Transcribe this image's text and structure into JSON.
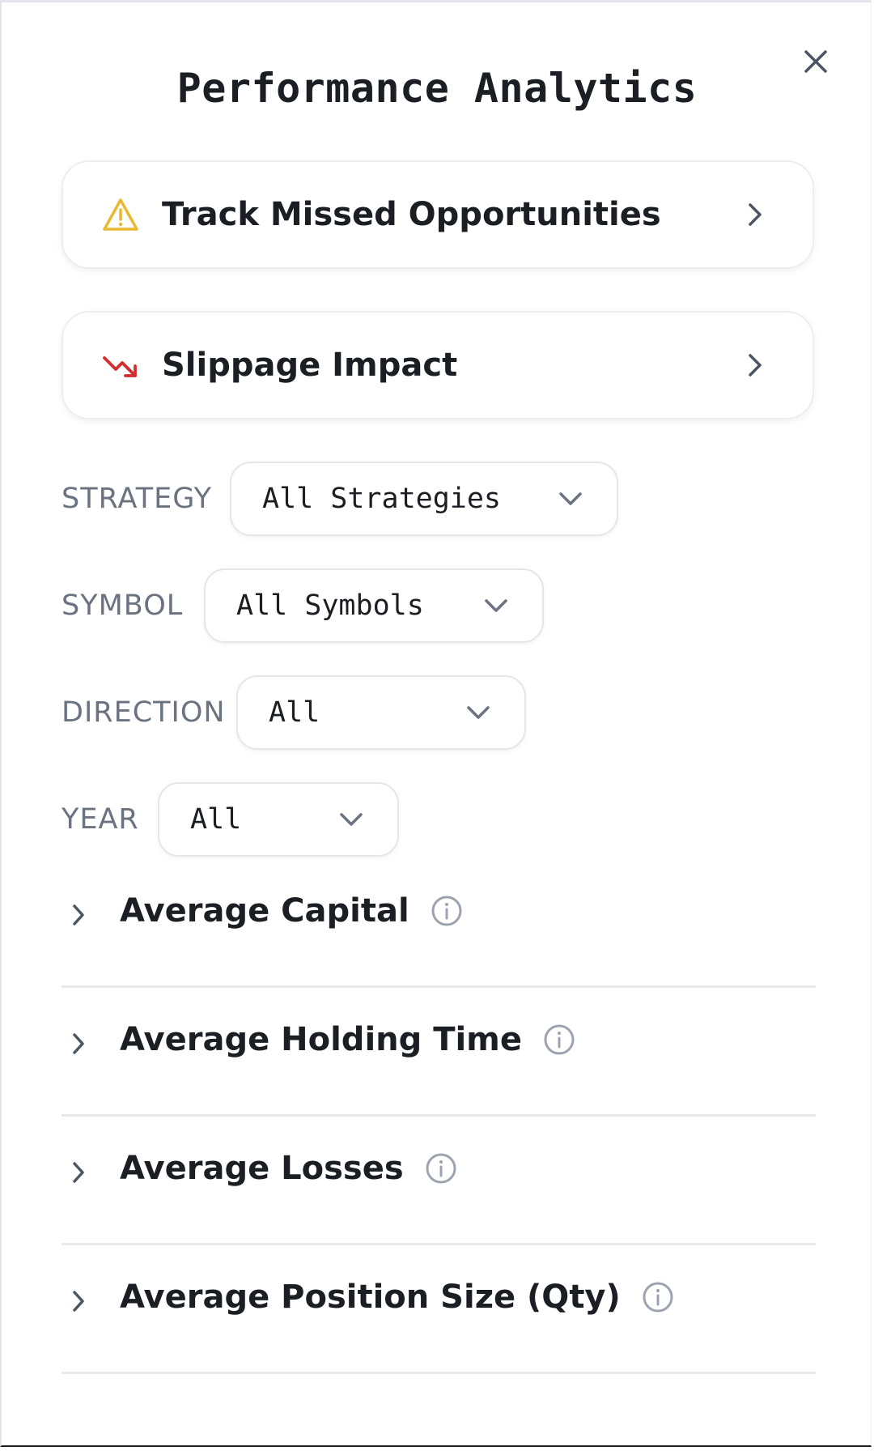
{
  "dialog": {
    "title": "Performance Analytics",
    "close_icon": "close-icon"
  },
  "nav_cards": [
    {
      "label": "Track Missed Opportunities",
      "icon": "warning-triangle-icon",
      "icon_color": "#e8b931"
    },
    {
      "label": "Slippage Impact",
      "icon": "trending-down-icon",
      "icon_color": "#d32f2f"
    }
  ],
  "filters": {
    "strategy": {
      "label": "STRATEGY",
      "value": "All Strategies"
    },
    "symbol": {
      "label": "SYMBOL",
      "value": "All Symbols"
    },
    "direction": {
      "label": "DIRECTION",
      "value": "All"
    },
    "year": {
      "label": "YEAR",
      "value": "All"
    }
  },
  "sections": [
    {
      "title": "Average Capital"
    },
    {
      "title": "Average Holding Time"
    },
    {
      "title": "Average Losses"
    },
    {
      "title": "Average Position Size (Qty)"
    }
  ],
  "colors": {
    "text": "#1b1f24",
    "muted": "#6b7280",
    "warning": "#e8b931",
    "danger": "#d32f2f"
  }
}
